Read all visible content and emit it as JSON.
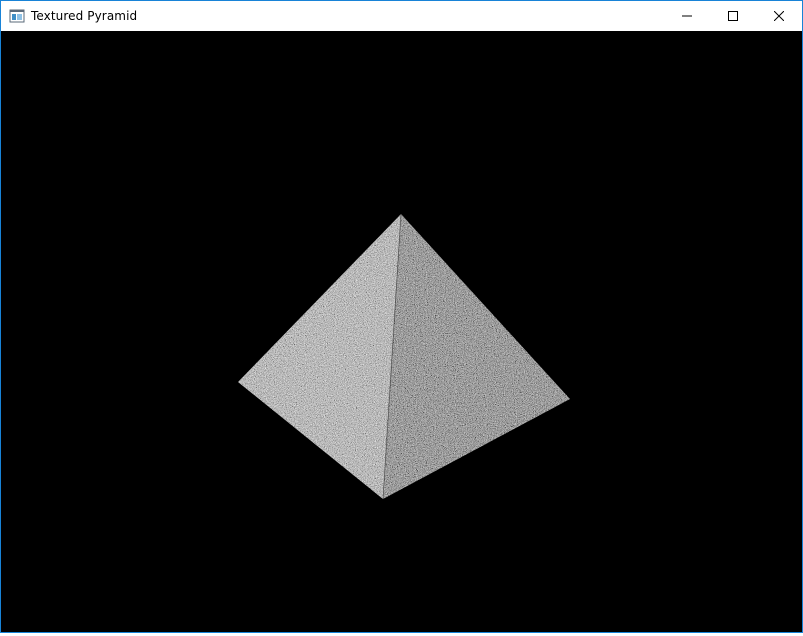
{
  "window": {
    "title": "Textured Pyramid"
  },
  "titlebar": {
    "app_icon": "window-app-icon",
    "minimize_icon": "minimize-icon",
    "maximize_icon": "maximize-icon",
    "close_icon": "close-icon"
  },
  "colors": {
    "window_border": "#1883d7",
    "titlebar_bg": "#ffffff",
    "viewport_bg": "#000000",
    "pyramid_texture": "#8a8a8a"
  },
  "scene": {
    "object": "textured-pyramid"
  }
}
